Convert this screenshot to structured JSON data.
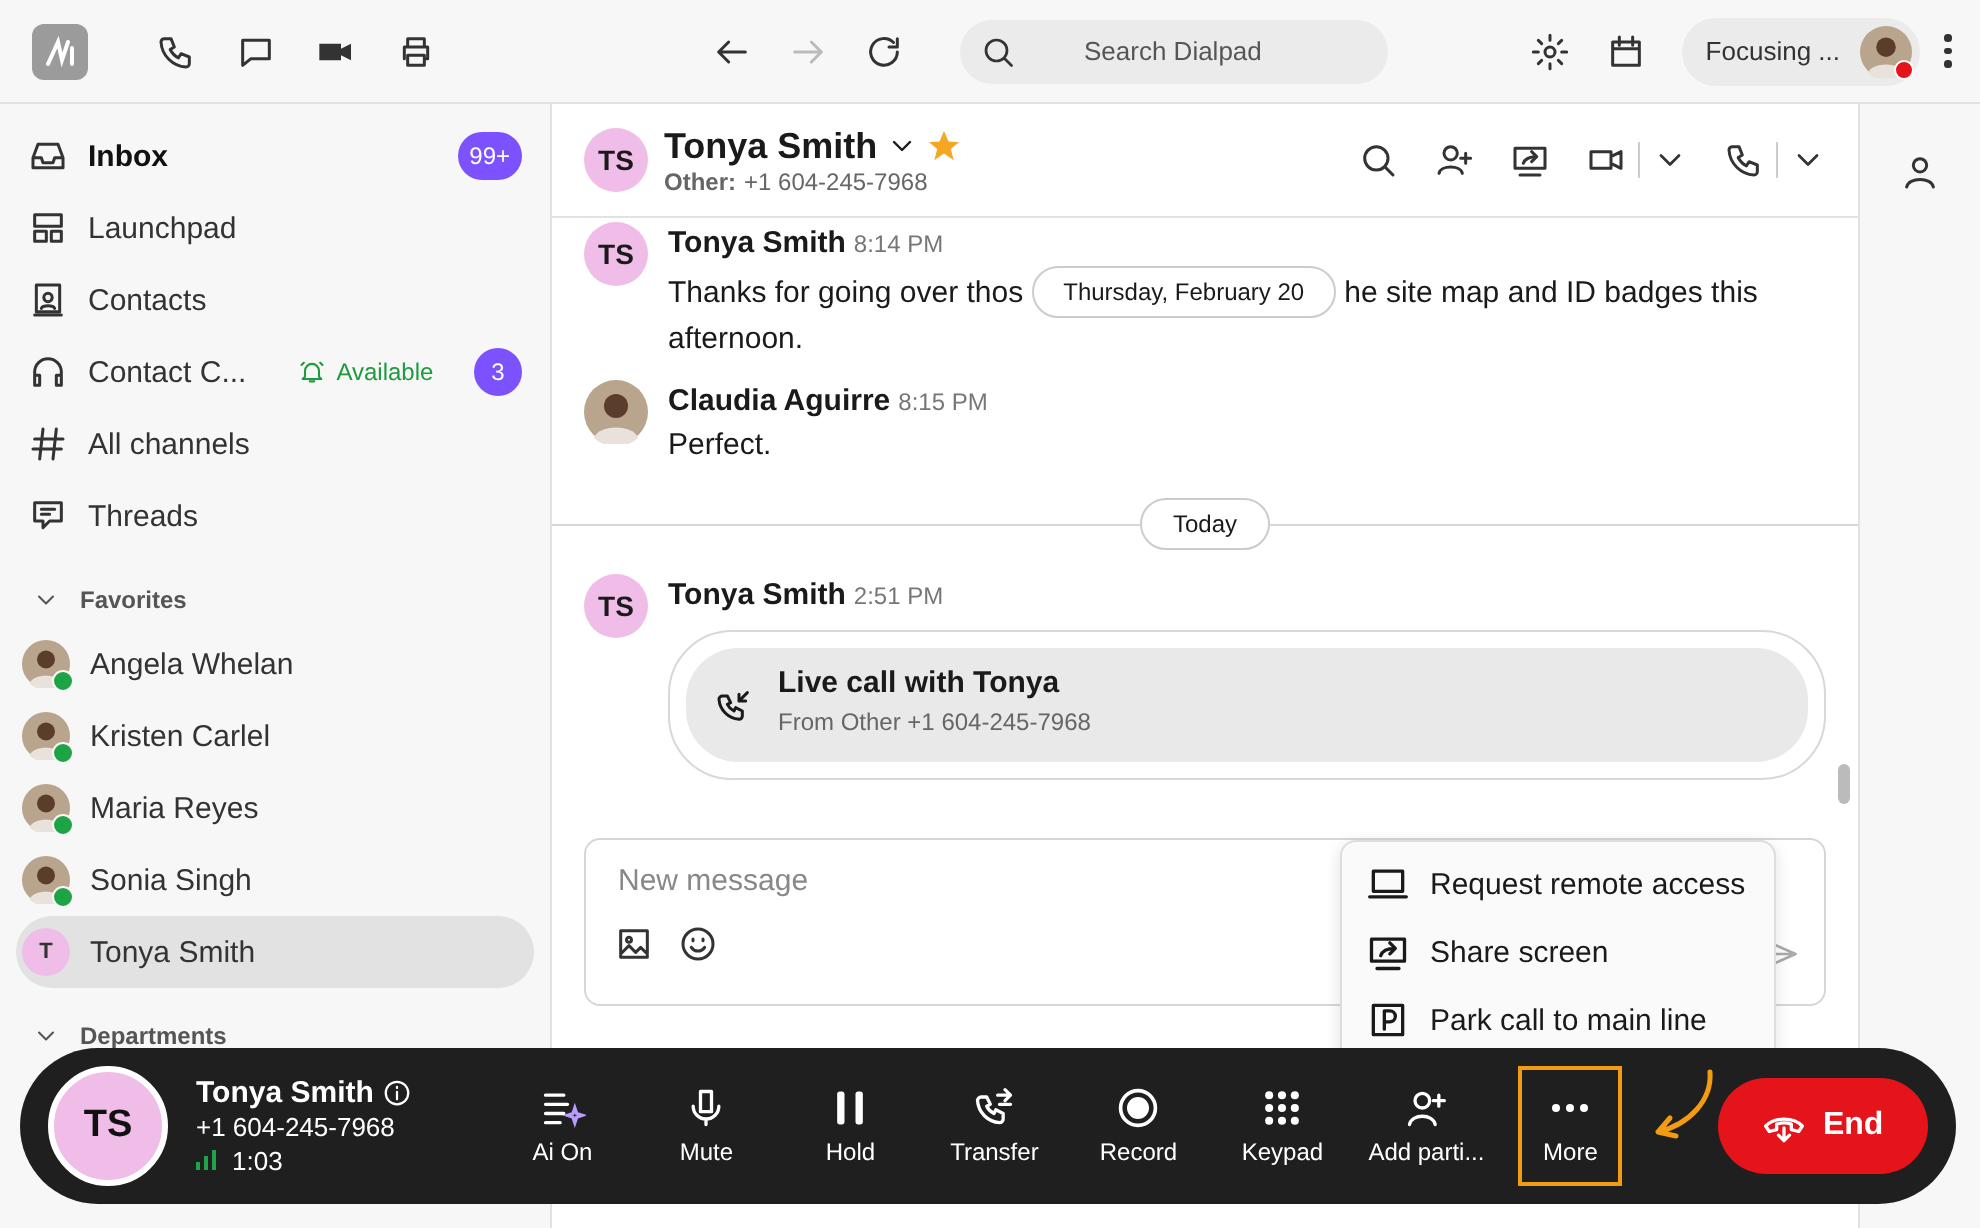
{
  "top_bar": {
    "search": {
      "placeholder": "Search Dialpad"
    },
    "status": {
      "label": "Focusing ...",
      "busy": true
    }
  },
  "sidebar": {
    "nav": [
      {
        "label": "Inbox",
        "unread": true,
        "badge": "99+"
      },
      {
        "label": "Launchpad",
        "unread": false
      },
      {
        "label": "Contacts",
        "unread": false
      },
      {
        "label": "Contact C...",
        "unread": false,
        "status": "Available",
        "badge": "3"
      },
      {
        "label": "All channels",
        "unread": false
      },
      {
        "label": "Threads",
        "unread": false
      }
    ],
    "favorites": {
      "title": "Favorites",
      "expanded": true,
      "items": [
        {
          "name": "Angela Whelan",
          "kind": "photo",
          "online": true,
          "selected": false
        },
        {
          "name": "Kristen Carlel",
          "kind": "photo",
          "online": true,
          "selected": false
        },
        {
          "name": "Maria Reyes",
          "kind": "photo",
          "online": true,
          "selected": false
        },
        {
          "name": "Sonia Singh",
          "kind": "photo",
          "online": true,
          "selected": false
        },
        {
          "name": "Tonya Smith",
          "kind": "initial",
          "initial": "T",
          "online": false,
          "selected": true
        }
      ]
    },
    "departments": {
      "title": "Departments",
      "expanded": true
    }
  },
  "conversation": {
    "initials": "TS",
    "name": "Tonya Smith",
    "starred": true,
    "subtitle_label": "Other:",
    "subtitle_number": "+1 604-245-7968",
    "messages": [
      {
        "kind": "message",
        "has_photo": false,
        "initials": "TS",
        "author": "Tonya Smith",
        "time": "8:14 PM",
        "text_before": "Thanks for going over thos",
        "floating_date": "Thursday, February 20",
        "text_after": "he site map and ID badges this",
        "text_continued": "afternoon."
      },
      {
        "kind": "message",
        "has_photo": true,
        "author": "Claudia Aguirre",
        "time": "8:15 PM",
        "text_before": "Perfect."
      },
      {
        "kind": "divider",
        "label": "Today"
      },
      {
        "kind": "call",
        "initials": "TS",
        "author": "Tonya Smith",
        "time": "2:51 PM",
        "title": "Live call with Tonya",
        "detail": "From Other +1 604-245-7968"
      }
    ],
    "composer": {
      "placeholder": "New message"
    }
  },
  "more_menu": [
    {
      "label": "Request remote access"
    },
    {
      "label": "Share screen"
    },
    {
      "label": "Park call to main line"
    }
  ],
  "call_bar": {
    "initials": "TS",
    "name": "Tonya Smith",
    "number": "+1 604-245-7968",
    "duration": "1:03",
    "controls": [
      {
        "label": "Ai On",
        "highlighted": false
      },
      {
        "label": "Mute",
        "highlighted": false
      },
      {
        "label": "Hold",
        "highlighted": false
      },
      {
        "label": "Transfer",
        "highlighted": false
      },
      {
        "label": "Record",
        "highlighted": false
      },
      {
        "label": "Keypad",
        "highlighted": false
      },
      {
        "label": "Add parti...",
        "highlighted": false
      },
      {
        "label": "More",
        "highlighted": true
      }
    ],
    "end_label": "End"
  }
}
